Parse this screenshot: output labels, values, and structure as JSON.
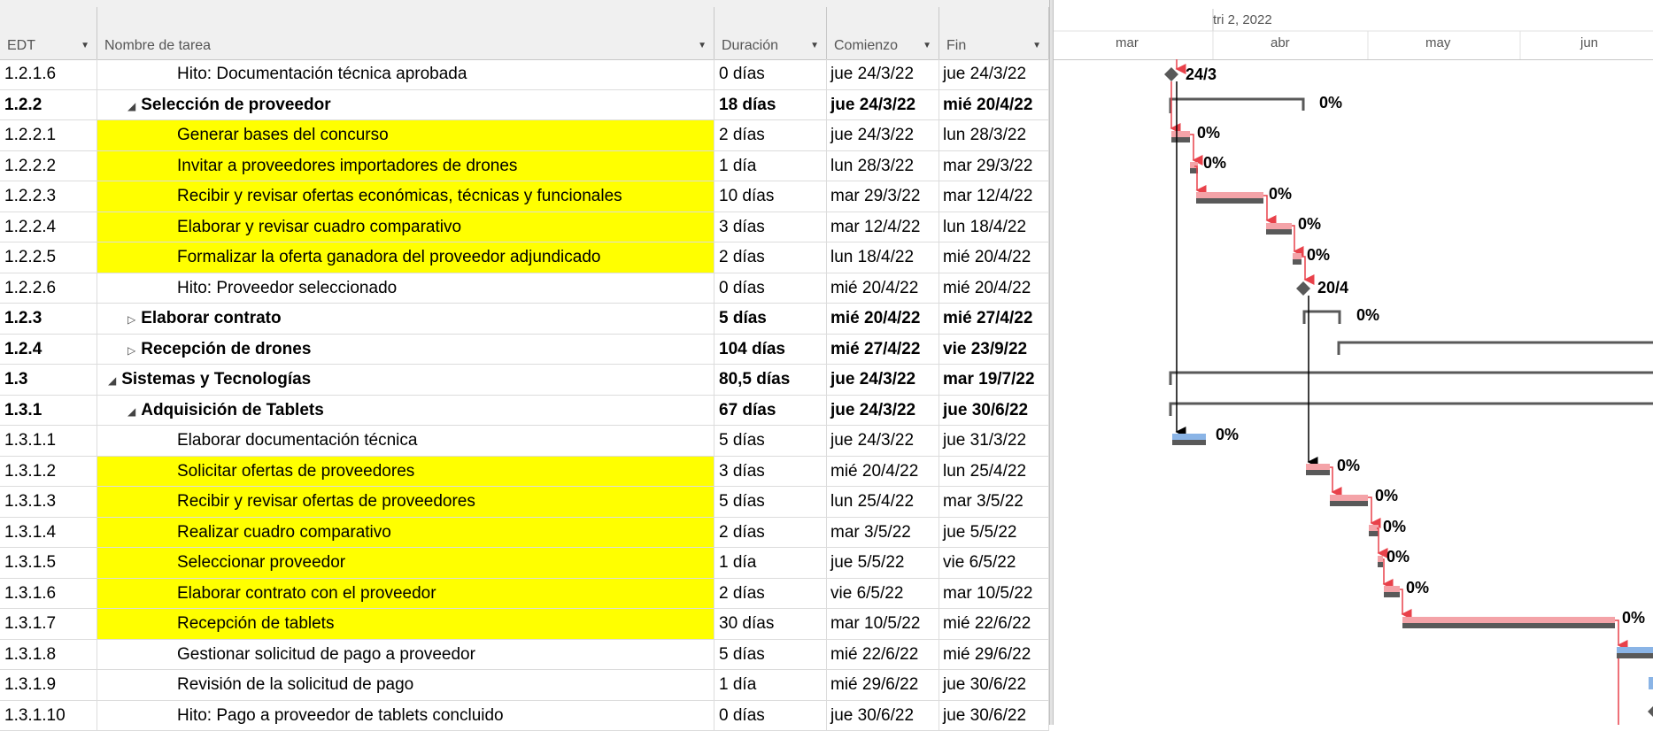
{
  "columns": {
    "edt": "EDT",
    "name": "Nombre de tarea",
    "duration": "Duración",
    "start": "Comienzo",
    "end": "Fin"
  },
  "timescale": {
    "top": "tri 2, 2022",
    "months": [
      "mar",
      "abr",
      "may",
      "jun"
    ]
  },
  "rows": [
    {
      "edt": "1.2.1.6",
      "name": "Hito: Documentación técnica aprobada",
      "dur": "0 días",
      "start": "jue 24/3/22",
      "end": "jue 24/3/22",
      "level": 3,
      "bold": false,
      "hl": false,
      "toggle": ""
    },
    {
      "edt": "1.2.2",
      "name": "Selección de proveedor",
      "dur": "18 días",
      "start": "jue 24/3/22",
      "end": "mié 20/4/22",
      "level": 2,
      "bold": true,
      "hl": false,
      "toggle": "◢"
    },
    {
      "edt": "1.2.2.1",
      "name": "Generar bases del concurso",
      "dur": "2 días",
      "start": "jue 24/3/22",
      "end": "lun 28/3/22",
      "level": 3,
      "bold": false,
      "hl": true,
      "toggle": ""
    },
    {
      "edt": "1.2.2.2",
      "name": "Invitar a proveedores importadores de drones",
      "dur": "1 día",
      "start": "lun 28/3/22",
      "end": "mar 29/3/22",
      "level": 3,
      "bold": false,
      "hl": true,
      "toggle": ""
    },
    {
      "edt": "1.2.2.3",
      "name": "Recibir y revisar ofertas económicas, técnicas y funcionales",
      "dur": "10 días",
      "start": "mar 29/3/22",
      "end": "mar 12/4/22",
      "level": 3,
      "bold": false,
      "hl": true,
      "toggle": ""
    },
    {
      "edt": "1.2.2.4",
      "name": "Elaborar y revisar cuadro comparativo",
      "dur": "3 días",
      "start": "mar 12/4/22",
      "end": "lun 18/4/22",
      "level": 3,
      "bold": false,
      "hl": true,
      "toggle": ""
    },
    {
      "edt": "1.2.2.5",
      "name": "Formalizar la oferta ganadora del proveedor adjundicado",
      "dur": "2 días",
      "start": "lun 18/4/22",
      "end": "mié 20/4/22",
      "level": 3,
      "bold": false,
      "hl": true,
      "toggle": ""
    },
    {
      "edt": "1.2.2.6",
      "name": "Hito: Proveedor seleccionado",
      "dur": "0 días",
      "start": "mié 20/4/22",
      "end": "mié 20/4/22",
      "level": 3,
      "bold": false,
      "hl": false,
      "toggle": ""
    },
    {
      "edt": "1.2.3",
      "name": "Elaborar contrato",
      "dur": "5 días",
      "start": "mié 20/4/22",
      "end": "mié 27/4/22",
      "level": 2,
      "bold": true,
      "hl": false,
      "toggle": "▷"
    },
    {
      "edt": "1.2.4",
      "name": "Recepción de drones",
      "dur": "104 días",
      "start": "mié 27/4/22",
      "end": "vie 23/9/22",
      "level": 2,
      "bold": true,
      "hl": false,
      "toggle": "▷"
    },
    {
      "edt": "1.3",
      "name": "Sistemas y Tecnologías",
      "dur": "80,5 días",
      "start": "jue 24/3/22",
      "end": "mar 19/7/22",
      "level": 1,
      "bold": true,
      "hl": false,
      "toggle": "◢"
    },
    {
      "edt": "1.3.1",
      "name": "Adquisición de Tablets",
      "dur": "67 días",
      "start": "jue 24/3/22",
      "end": "jue 30/6/22",
      "level": 2,
      "bold": true,
      "hl": false,
      "toggle": "◢"
    },
    {
      "edt": "1.3.1.1",
      "name": "Elaborar documentación técnica",
      "dur": "5 días",
      "start": "jue 24/3/22",
      "end": "jue 31/3/22",
      "level": 3,
      "bold": false,
      "hl": false,
      "toggle": ""
    },
    {
      "edt": "1.3.1.2",
      "name": "Solicitar ofertas de proveedores",
      "dur": "3 días",
      "start": "mié 20/4/22",
      "end": "lun 25/4/22",
      "level": 3,
      "bold": false,
      "hl": true,
      "toggle": ""
    },
    {
      "edt": "1.3.1.3",
      "name": "Recibir y revisar ofertas de proveedores",
      "dur": "5 días",
      "start": "lun 25/4/22",
      "end": "mar 3/5/22",
      "level": 3,
      "bold": false,
      "hl": true,
      "toggle": ""
    },
    {
      "edt": "1.3.1.4",
      "name": "Realizar cuadro comparativo",
      "dur": "2 días",
      "start": "mar 3/5/22",
      "end": "jue 5/5/22",
      "level": 3,
      "bold": false,
      "hl": true,
      "toggle": ""
    },
    {
      "edt": "1.3.1.5",
      "name": "Seleccionar proveedor",
      "dur": "1 día",
      "start": "jue 5/5/22",
      "end": "vie 6/5/22",
      "level": 3,
      "bold": false,
      "hl": true,
      "toggle": ""
    },
    {
      "edt": "1.3.1.6",
      "name": "Elaborar contrato con el proveedor",
      "dur": "2 días",
      "start": "vie 6/5/22",
      "end": "mar 10/5/22",
      "level": 3,
      "bold": false,
      "hl": true,
      "toggle": ""
    },
    {
      "edt": "1.3.1.7",
      "name": "Recepción de tablets",
      "dur": "30 días",
      "start": "mar 10/5/22",
      "end": "mié 22/6/22",
      "level": 3,
      "bold": false,
      "hl": true,
      "toggle": ""
    },
    {
      "edt": "1.3.1.8",
      "name": "Gestionar solicitud de pago a proveedor",
      "dur": "5 días",
      "start": "mié 22/6/22",
      "end": "mié 29/6/22",
      "level": 3,
      "bold": false,
      "hl": false,
      "toggle": ""
    },
    {
      "edt": "1.3.1.9",
      "name": "Revisión de la solicitud de pago",
      "dur": "1 día",
      "start": "mié 29/6/22",
      "end": "jue 30/6/22",
      "level": 3,
      "bold": false,
      "hl": false,
      "toggle": ""
    },
    {
      "edt": "1.3.1.10",
      "name": "Hito: Pago a proveedor de tablets concluido",
      "dur": "0 días",
      "start": "jue 30/6/22",
      "end": "jue 30/6/22",
      "level": 3,
      "bold": false,
      "hl": false,
      "toggle": ""
    }
  ],
  "gantt_labels": {
    "m1": "24/3",
    "m2": "20/4",
    "pct": "0%"
  },
  "colors": {
    "highlight": "#ffff00",
    "critical_bar": "#f4a3a8",
    "normal_bar": "#8ab4e6",
    "progress": "#595959",
    "link_critical": "#e8414a",
    "link_normal": "#000000"
  }
}
